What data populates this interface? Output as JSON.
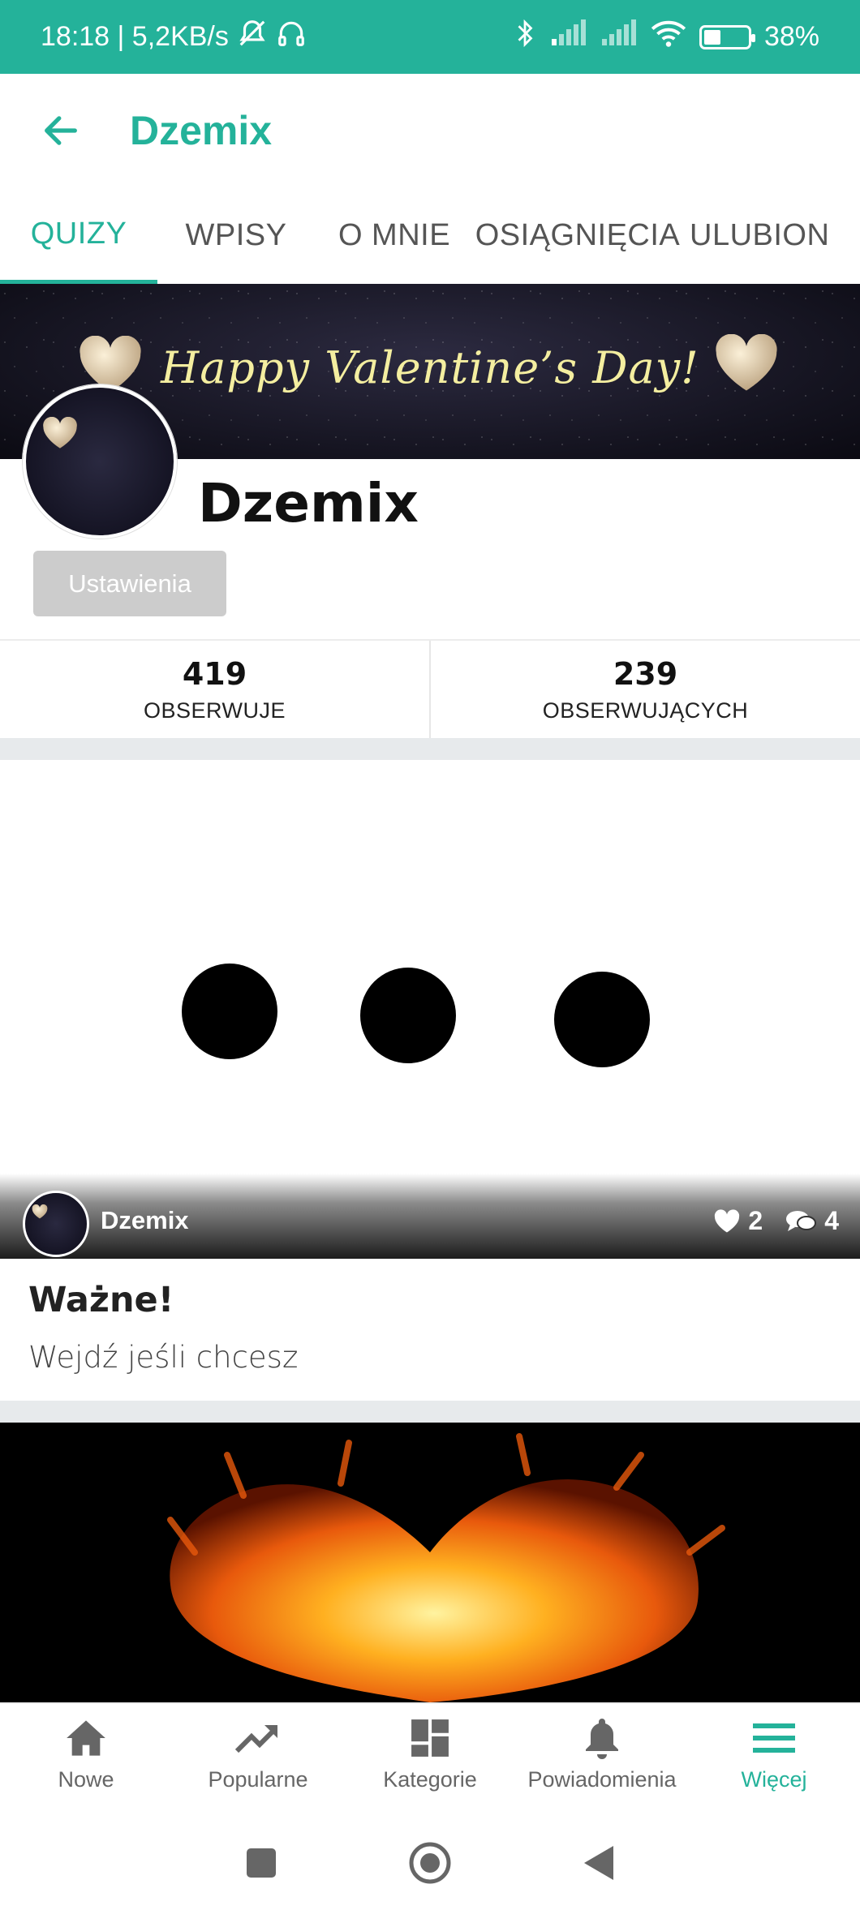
{
  "status_bar": {
    "time_speed": "18:18 | 5,2KB/s",
    "battery": "38%",
    "battery_level": 0.38
  },
  "app_bar": {
    "title": "Dzemix"
  },
  "tabs": [
    {
      "label": "QUIZY",
      "active": true
    },
    {
      "label": "WPISY",
      "active": false
    },
    {
      "label": "O MNIE",
      "active": false
    },
    {
      "label": "OSIĄGNIĘCIA",
      "active": false
    },
    {
      "label": "ULUBION",
      "active": false
    }
  ],
  "banner": {
    "text": "Happy Valentine’s Day!"
  },
  "profile": {
    "name": "Dzemix",
    "settings_label": "Ustawienia"
  },
  "stats": {
    "following_count": "419",
    "following_label": "OBSERWUJE",
    "followers_count": "239",
    "followers_label": "OBSERWUJĄCYCH"
  },
  "quizzes": [
    {
      "author": "Dzemix",
      "likes": "2",
      "comments": "4",
      "title": "Ważne!",
      "description": "Wejdź jeśli chcesz"
    }
  ],
  "bottom_nav": [
    {
      "label": "Nowe",
      "icon": "home-icon"
    },
    {
      "label": "Popularne",
      "icon": "trending-icon"
    },
    {
      "label": "Kategorie",
      "icon": "categories-icon"
    },
    {
      "label": "Powiadomienia",
      "icon": "bell-icon"
    },
    {
      "label": "Więcej",
      "icon": "menu-icon",
      "active": true
    }
  ],
  "colors": {
    "accent": "#24b29a",
    "inactive": "#666666"
  }
}
